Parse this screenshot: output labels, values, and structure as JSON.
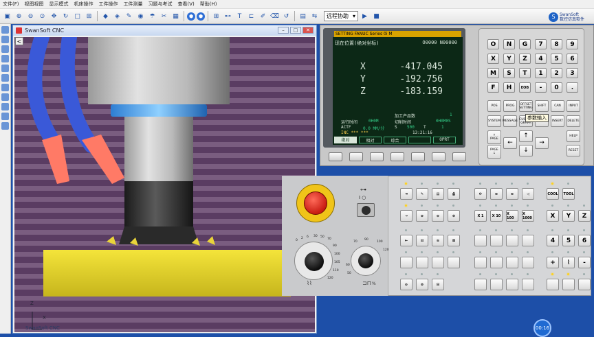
{
  "menu": [
    "文件(F)",
    "视图视图",
    "显示模式",
    "机床操作",
    "工件操作",
    "工件测量",
    "习题与考试",
    "查看(V)",
    "帮助(H)"
  ],
  "toolbar": {
    "mode_combo": "远程协助"
  },
  "brand": {
    "line1": "SwanSoft",
    "line2": "数控仿真软件"
  },
  "viewport": {
    "title": "SwanSoft CNC",
    "back_label": "<",
    "footer": "SwanSoft CNC",
    "axis_x": "X",
    "axis_z": "Z"
  },
  "lcd": {
    "header_brand": "SETTING FANUC Series 0i M",
    "title": "现在位置(绝对坐标)",
    "prog": "O0000 N00000",
    "axes": [
      {
        "name": "X",
        "value": "-417.045"
      },
      {
        "name": "Y",
        "value": "-192.756"
      },
      {
        "name": "Z",
        "value": "-183.159"
      }
    ],
    "parts_label": "加工产品数",
    "parts_value": "1",
    "run_time_label": "运行时间",
    "run_time_value": "0H0M",
    "cycle_time_label": "切削时间",
    "cycle_time_value": "0H0M0S",
    "actf_label": "ACTF",
    "actf_value": "0.0 MM/分",
    "s_label": "S",
    "s_value": "500",
    "t_label": "T",
    "t_value": "1",
    "inc_label": "INC ***  ***",
    "clock": "13:21:16",
    "softkeys": [
      "绝对",
      "相对",
      "综合",
      "",
      "OPRT"
    ]
  },
  "keypad": {
    "letters": [
      "O",
      "N",
      "G",
      "7",
      "8",
      "9",
      "X",
      "Y",
      "Z",
      "4",
      "5",
      "6",
      "M",
      "S",
      "T",
      "1",
      "2",
      "3",
      "F",
      "H",
      "EOB",
      "-",
      "0",
      "."
    ],
    "functions": [
      "POS",
      "PROG",
      "OFFSET SETTING",
      "SHIFT",
      "CAN",
      "INPUT",
      "SYSTEM",
      "MESSAGE",
      "CUSTOM GRAPH",
      "ALTER",
      "INSERT",
      "DELETE"
    ],
    "page_up": "PAGE",
    "page_down": "PAGE",
    "help": "HELP",
    "reset": "RESET",
    "tooltip": "参数输入"
  },
  "mop": {
    "dial_left_ticks": [
      "0",
      "2",
      "4",
      "6",
      "8",
      "10",
      "15",
      "20",
      "30",
      "40",
      "50",
      "60",
      "70",
      "80",
      "90",
      "95",
      "100",
      "105",
      "110",
      "120"
    ],
    "dial_right_ticks": [
      "50",
      "60",
      "70",
      "80",
      "90",
      "100",
      "110",
      "120"
    ],
    "jog_buttons": [
      "X 1",
      "X 10",
      "X 100",
      "X 1000"
    ],
    "coolant": "COOL",
    "tool": "TOOL",
    "axis_buttons": [
      "X",
      "Y",
      "Z",
      "4",
      "5",
      "6",
      "+",
      "-"
    ],
    "dial_right_unit": "%"
  },
  "timer": "00:16",
  "colors": {
    "background": "#1d4fa8",
    "lcd": "#0c2816",
    "estop": "#c81c12",
    "workpiece": "#e5d72a",
    "hose_blue": "#3a59d8",
    "nozzle": "#ff7a66"
  }
}
